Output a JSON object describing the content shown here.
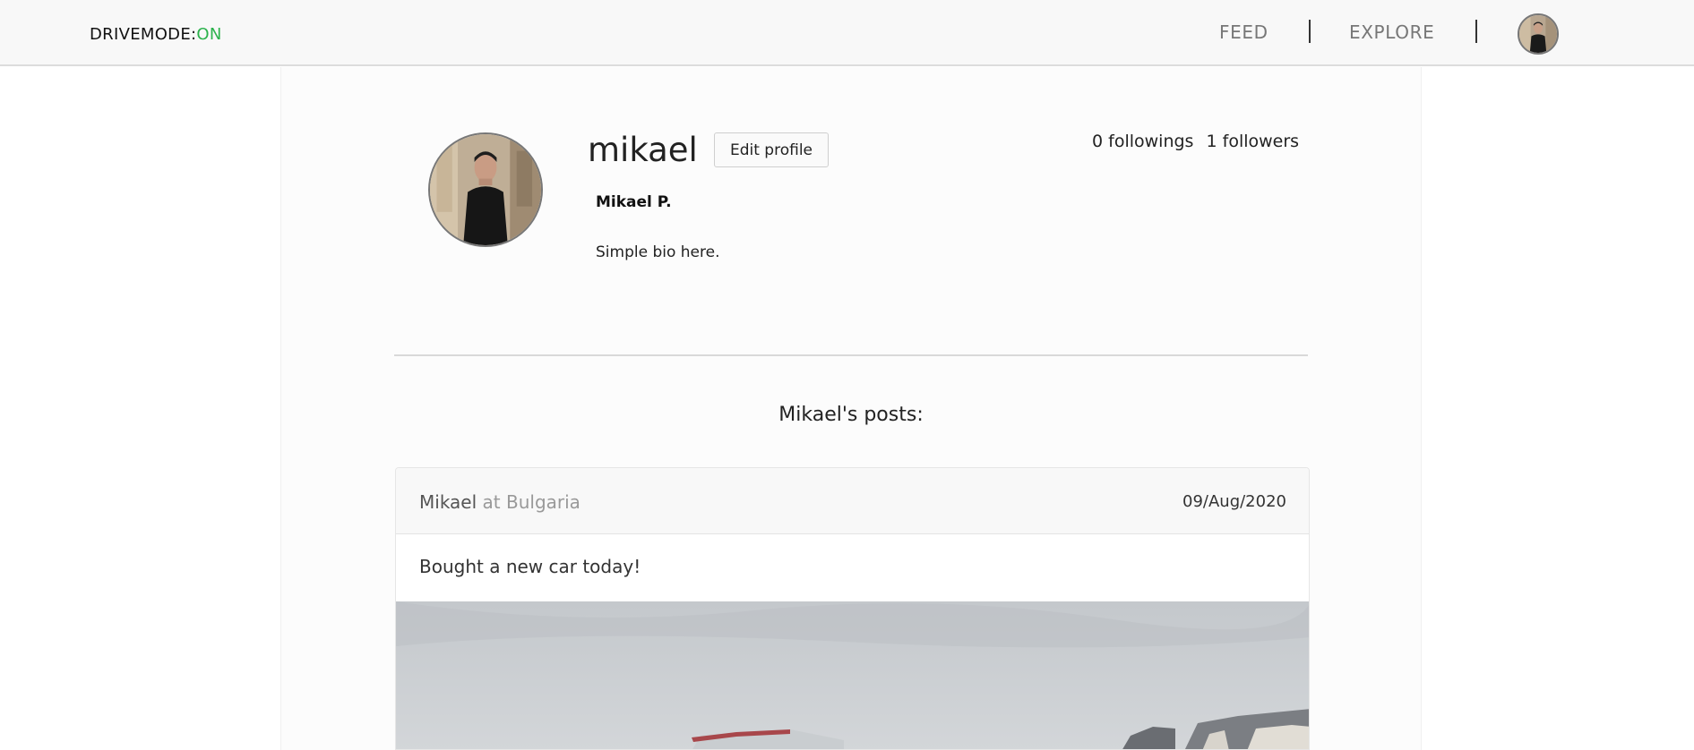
{
  "navbar": {
    "brand_main": "DRIVEMODE:",
    "brand_accent": "ON",
    "links": [
      {
        "label": "FEED"
      },
      {
        "label": "EXPLORE"
      }
    ]
  },
  "profile": {
    "username": "mikael",
    "edit_button": "Edit profile",
    "followings": "0 followings",
    "followers": "1 followers",
    "full_name": "Mikael P.",
    "bio": "Simple bio here."
  },
  "posts": {
    "title": "Mikael's posts:",
    "items": [
      {
        "author": "Mikael",
        "location": "at Bulgaria",
        "date": "09/Aug/2020",
        "text": "Bought a new car today!"
      }
    ]
  },
  "colors": {
    "accent": "#2bb24c",
    "navbar_bg": "#f8f8f8"
  }
}
